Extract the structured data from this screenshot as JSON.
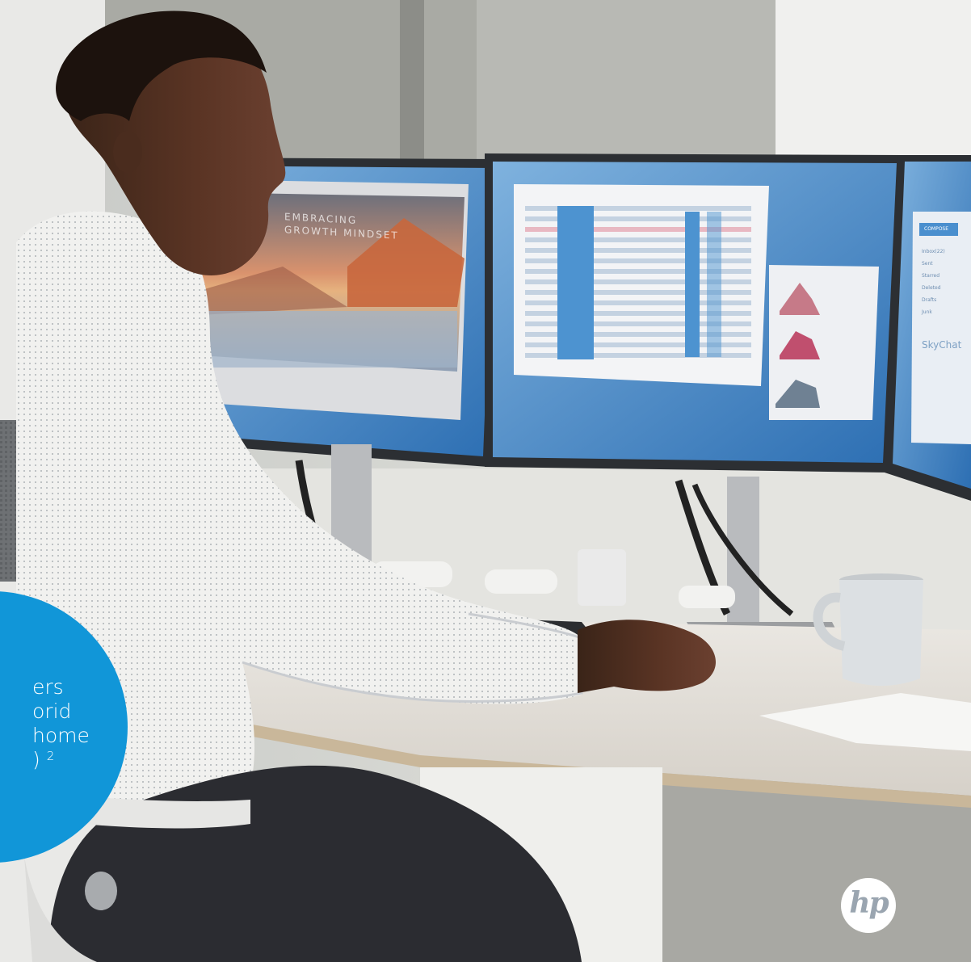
{
  "image": {
    "alt": "Man in a white shirt working at a desk with three monitors"
  },
  "badge": {
    "lines": [
      "ers",
      "orid",
      "home"
    ],
    "last_line": ")",
    "footnote": "2",
    "color": "#1196d8"
  },
  "screens": {
    "left_slide_title": "EMBRACING\nGROWTH MINDSET",
    "right_app": {
      "compose": "COMPOSE",
      "folders": [
        "Inbox(22)",
        "Sent",
        "Starred",
        "Deleted",
        "Drafts",
        "Junk"
      ],
      "chat_title": "SkyChat"
    }
  },
  "brand": {
    "logo_text": "hp",
    "logo_color": "#ffffff"
  }
}
